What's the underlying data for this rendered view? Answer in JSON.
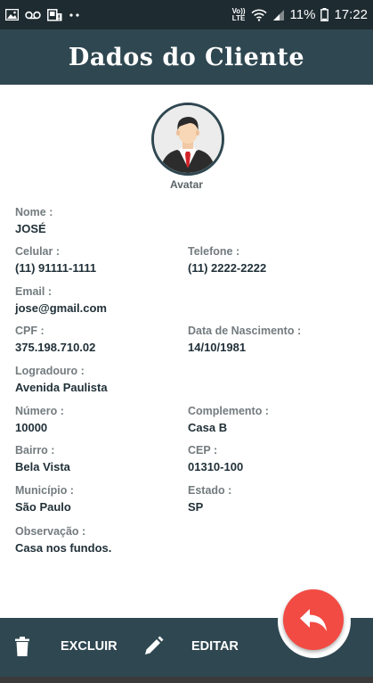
{
  "status_bar": {
    "battery": "11%",
    "time": "17:22",
    "network_top": "Vo))",
    "network_bottom": "LTE",
    "left_icons": [
      "image-icon",
      "voicemail-icon",
      "sim-alert-icon",
      "more-dots-icon"
    ],
    "right_icons": [
      "volte-icon",
      "wifi-icon",
      "signal-icon",
      "battery-icon"
    ]
  },
  "header": {
    "title": "Dados do Cliente"
  },
  "avatar": {
    "label": "Avatar"
  },
  "fields": {
    "nome": {
      "label": "Nome :",
      "value": "JOSÉ"
    },
    "celular": {
      "label": "Celular :",
      "value": "(11) 91111-1111"
    },
    "telefone": {
      "label": "Telefone :",
      "value": "(11) 2222-2222"
    },
    "email": {
      "label": "Email :",
      "value": "jose@gmail.com"
    },
    "cpf": {
      "label": "CPF :",
      "value": "375.198.710.02"
    },
    "nascimento": {
      "label": "Data de Nascimento :",
      "value": "14/10/1981"
    },
    "logradouro": {
      "label": "Logradouro :",
      "value": "Avenida Paulista"
    },
    "numero": {
      "label": "Número :",
      "value": "10000"
    },
    "complemento": {
      "label": "Complemento :",
      "value": "Casa B"
    },
    "bairro": {
      "label": "Bairro :",
      "value": "Bela Vista"
    },
    "cep": {
      "label": "CEP :",
      "value": "01310-100"
    },
    "municipio": {
      "label": "Município :",
      "value": "São Paulo"
    },
    "estado": {
      "label": "Estado :",
      "value": "SP"
    },
    "observacao": {
      "label": "Observação :",
      "value": "Casa nos fundos."
    }
  },
  "bottom_bar": {
    "delete_label": "EXCLUIR",
    "edit_label": "EDITAR",
    "delete_icon": "trash-icon",
    "edit_icon": "pencil-icon"
  },
  "fab": {
    "icon": "reply-arrow-icon"
  },
  "colors": {
    "status_bar": "#1e2b31",
    "primary": "#2f4750",
    "fab": "#f24b43",
    "label": "#737b7e",
    "value": "#213139"
  }
}
